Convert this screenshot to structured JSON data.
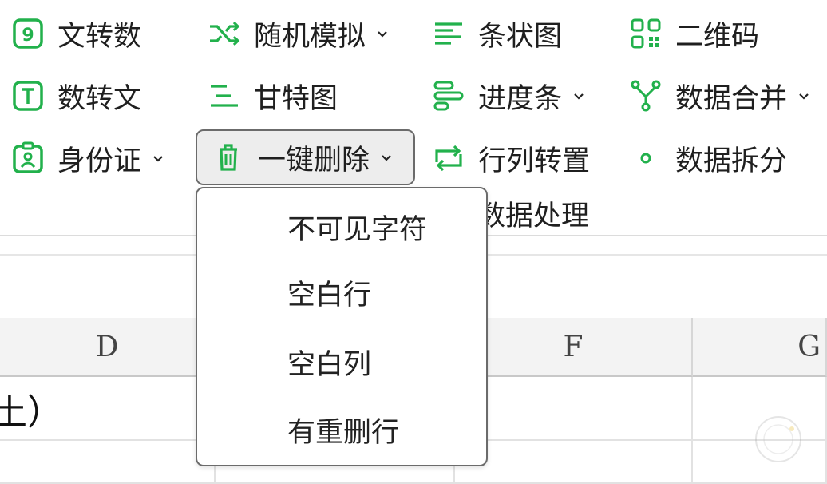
{
  "ribbon": {
    "col1": [
      {
        "label": "文转数",
        "icon": "number-9-icon"
      },
      {
        "label": "数转文",
        "icon": "text-t-icon"
      },
      {
        "label": "身份证",
        "icon": "id-card-icon",
        "dropdown": true
      }
    ],
    "col2": [
      {
        "label": "随机模拟",
        "icon": "shuffle-icon",
        "dropdown": true
      },
      {
        "label": "甘特图",
        "icon": "gantt-icon"
      },
      {
        "label": "一键删除",
        "icon": "trash-icon",
        "dropdown": true
      }
    ],
    "col3": [
      {
        "label": "条状图",
        "icon": "bar-lines-icon"
      },
      {
        "label": "进度条",
        "icon": "progress-bar-icon",
        "dropdown": true
      },
      {
        "label": "行列转置",
        "icon": "transpose-icon"
      }
    ],
    "col4": [
      {
        "label": "二维码",
        "icon": "qr-code-icon"
      },
      {
        "label": "数据合并",
        "icon": "merge-icon",
        "dropdown": true
      },
      {
        "label": "数据拆分",
        "icon": "split-dot-icon"
      }
    ],
    "group_label": "数据处理"
  },
  "sheet": {
    "columns": [
      "D",
      "F",
      "G"
    ],
    "cell_fragment": "土）"
  },
  "dropdown_menu": {
    "items": [
      "不可见字符",
      "空白行",
      "空白列",
      "有重删行"
    ]
  },
  "colors": {
    "accent": "#22b14c",
    "active_bg": "#ededed",
    "border": "#6b6b6b"
  }
}
